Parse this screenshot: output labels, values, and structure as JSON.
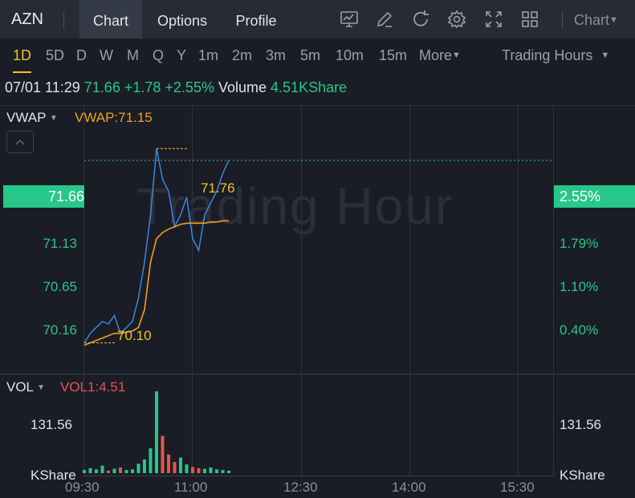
{
  "header": {
    "symbol": "AZN",
    "tabs": [
      {
        "label": "Chart",
        "active": true
      },
      {
        "label": "Options",
        "active": false
      },
      {
        "label": "Profile",
        "active": false
      }
    ],
    "toolbar_icons": [
      "chart-line-icon",
      "draw-icon",
      "refresh-icon",
      "settings-icon",
      "fullscreen-icon",
      "layout-grid-icon"
    ],
    "chart_type_dropdown": "Chart"
  },
  "periods": {
    "items": [
      "1D",
      "5D",
      "D",
      "W",
      "M",
      "Q",
      "Y",
      "1m",
      "2m",
      "3m",
      "5m",
      "10m",
      "15m",
      "More"
    ],
    "active": "1D",
    "session": "Trading Hours"
  },
  "quote": {
    "datetime": "07/01 11:29",
    "price": "71.66",
    "change": "+1.78",
    "change_pct": "+2.55%",
    "volume_label": "Volume",
    "volume": "4.51KShare"
  },
  "price_panel": {
    "indicator": "VWAP",
    "indicator_value": "VWAP:71.15",
    "watermark": "Trading Hour",
    "current_price": "71.66",
    "current_pct": "2.55%",
    "high_label": "71.76",
    "low_label": "70.10",
    "left_axis": [
      "71.13",
      "70.65",
      "70.16"
    ],
    "right_axis": [
      "1.79%",
      "1.10%",
      "0.40%"
    ]
  },
  "volume_panel": {
    "indicator": "VOL",
    "indicator_value": "VOL1:4.51",
    "left_axis": "131.56",
    "right_axis": "131.56",
    "unit": "KShare"
  },
  "x_axis": [
    "09:30",
    "11:00",
    "12:30",
    "14:00",
    "15:30"
  ],
  "colors": {
    "up": "#27c78a",
    "down": "#e8554e",
    "accent": "#f5c125",
    "price_line": "#3b8eea",
    "vwap_line": "#f0a020"
  },
  "chart_data": {
    "type": "line",
    "x": [
      "09:30",
      "09:35",
      "09:40",
      "09:45",
      "09:50",
      "09:55",
      "10:00",
      "10:05",
      "10:10",
      "10:15",
      "10:20",
      "10:25",
      "10:30",
      "10:35",
      "10:40",
      "10:45",
      "10:50",
      "10:55",
      "11:00",
      "11:05",
      "11:10",
      "11:15",
      "11:20",
      "11:25",
      "11:29"
    ],
    "series": [
      {
        "values": [
          70.12,
          70.2,
          70.25,
          70.3,
          70.28,
          70.35,
          70.2,
          70.25,
          70.3,
          70.5,
          70.8,
          71.2,
          71.76,
          71.5,
          71.4,
          71.1,
          71.2,
          71.35,
          71.0,
          70.9,
          71.2,
          71.3,
          71.4,
          71.55,
          71.66
        ]
      },
      {
        "values": [
          70.1,
          70.12,
          70.14,
          70.16,
          70.18,
          70.2,
          70.2,
          70.21,
          70.22,
          70.25,
          70.4,
          70.8,
          71.0,
          71.05,
          71.08,
          71.1,
          71.12,
          71.13,
          71.13,
          71.13,
          71.13,
          71.14,
          71.14,
          71.15,
          71.15
        ]
      }
    ],
    "volume_values": [
      5,
      8,
      6,
      12,
      4,
      7,
      9,
      5,
      6,
      15,
      22,
      40,
      131.56,
      60,
      30,
      18,
      25,
      14,
      10,
      8,
      7,
      9,
      6,
      5,
      4
    ],
    "ylim": [
      69.9,
      72.1
    ],
    "yticks": [
      70.16,
      70.65,
      71.13,
      71.66
    ],
    "xticks": [
      "09:30",
      "11:00",
      "12:30",
      "14:00",
      "15:30"
    ]
  }
}
